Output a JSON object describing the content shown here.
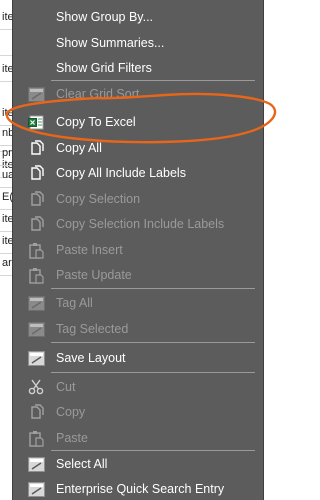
{
  "background_rows": [
    "ite",
    "",
    "ite",
    "nb",
    "ite",
    "",
    "ite",
    "pn",
    "ua",
    "E(",
    "ite",
    "ite",
    "ar"
  ],
  "menu": {
    "items": [
      {
        "label": "Show Group By...",
        "disabled": false,
        "icon": "none"
      },
      {
        "label": "Show Summaries...",
        "disabled": false,
        "icon": "none"
      },
      {
        "label": "Show Grid Filters",
        "disabled": false,
        "icon": "none"
      },
      {
        "label": "Clear Grid Sort",
        "disabled": true,
        "icon": "grid-sort-icon"
      },
      {
        "label": "Copy To Excel",
        "disabled": false,
        "icon": "excel-icon"
      },
      {
        "label": "Copy All",
        "disabled": false,
        "icon": "copy-icon"
      },
      {
        "label": "Copy All Include Labels",
        "disabled": false,
        "icon": "copy-icon"
      },
      {
        "label": "Copy Selection",
        "disabled": true,
        "icon": "copy-icon"
      },
      {
        "label": "Copy Selection Include Labels",
        "disabled": true,
        "icon": "copy-icon"
      },
      {
        "label": "Paste Insert",
        "disabled": true,
        "icon": "paste-icon"
      },
      {
        "label": "Paste Update",
        "disabled": true,
        "icon": "paste-icon"
      },
      {
        "label": "Tag All",
        "disabled": true,
        "icon": "grid-icon"
      },
      {
        "label": "Tag Selected",
        "disabled": true,
        "icon": "grid-icon"
      },
      {
        "label": "Save Layout",
        "disabled": false,
        "icon": "grid-icon"
      },
      {
        "label": "Cut",
        "disabled": true,
        "icon": "scissors-icon"
      },
      {
        "label": "Copy",
        "disabled": true,
        "icon": "copy-icon"
      },
      {
        "label": "Paste",
        "disabled": true,
        "icon": "paste-icon"
      },
      {
        "label": "Select All",
        "disabled": false,
        "icon": "grid-icon"
      },
      {
        "label": "Enterprise Quick Search Entry",
        "disabled": false,
        "icon": "grid-icon"
      }
    ]
  },
  "colors": {
    "menu_bg": "#5c5c5c",
    "text_enabled": "#ffffff",
    "text_disabled": "#9a9a9a",
    "annotation": "#e8661a"
  }
}
